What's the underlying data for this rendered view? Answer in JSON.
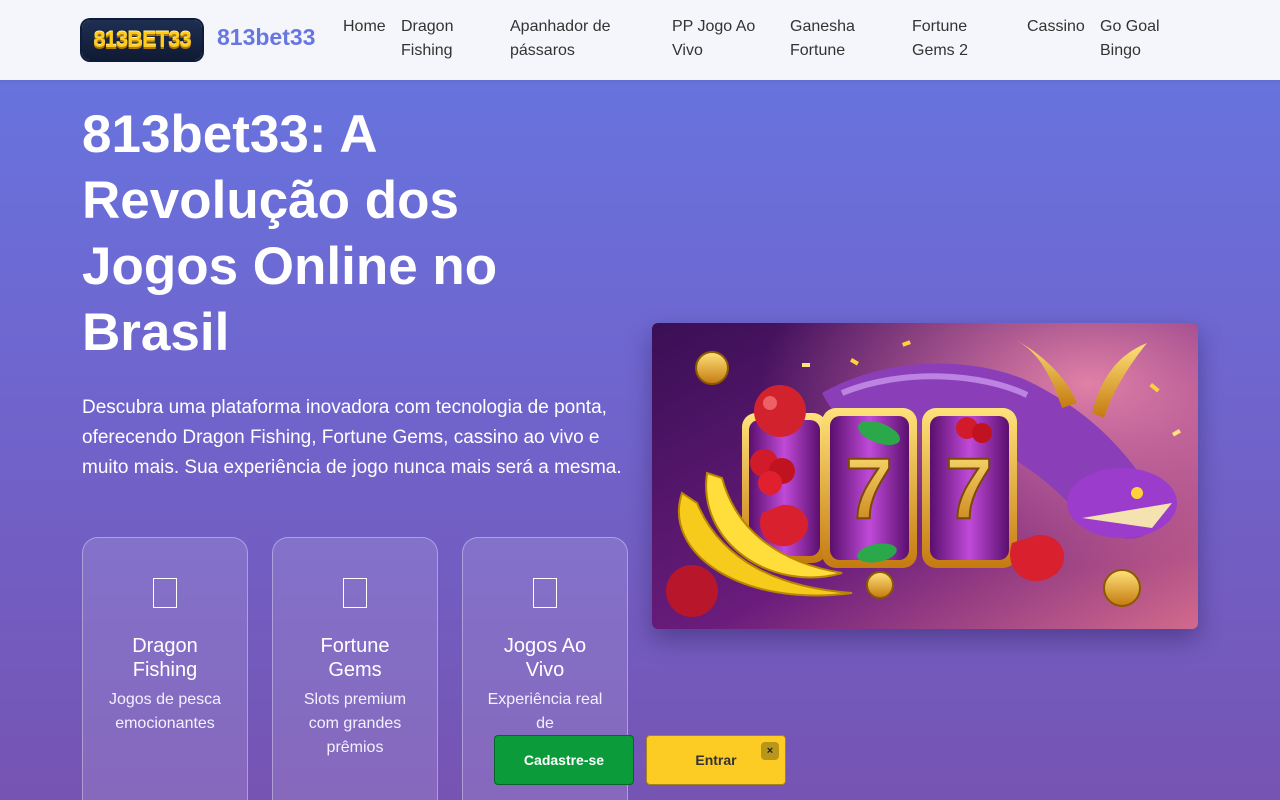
{
  "header": {
    "logo_text": "813BET33",
    "brand": "813bet33",
    "nav": [
      "Home",
      "Dragon Fishing",
      "Apanhador de pássaros",
      "PP Jogo Ao Vivo",
      "Ganesha Fortune",
      "Fortune Gems 2",
      "Cassino",
      "Go Goal Bingo"
    ]
  },
  "hero": {
    "title": "813bet33: A Revolução dos Jogos Online no Brasil",
    "description": "Descubra uma plataforma inovadora com tecnologia de ponta, oferecendo Dragon Fishing, Fortune Gems, cassino ao vivo e muito mais. Sua experiência de jogo nunca mais será a mesma.",
    "image_icon": "slot-machine-dragon-image"
  },
  "features": [
    {
      "title": "Dragon Fishing",
      "desc": "Jogos de pesca emocionantes"
    },
    {
      "title": "Fortune Gems",
      "desc": "Slots premium com grandes prêmios"
    },
    {
      "title": "Jogos Ao Vivo",
      "desc": "Experiência real de"
    }
  ],
  "cta": {
    "register": "Cadastre-se",
    "login": "Entrar",
    "close": "×"
  },
  "colors": {
    "brand": "#6677e2",
    "register": "#0c9b3a",
    "login": "#fccb24"
  }
}
